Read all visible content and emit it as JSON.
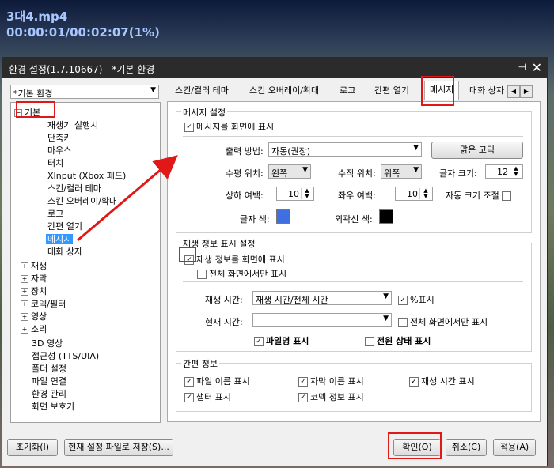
{
  "video": {
    "filename": "3대4.mp4",
    "time": "00:00:01/00:02:07(1%)"
  },
  "dialog": {
    "title": "환경 설정(1.7.10667) - *기본 환경",
    "pin_icon": "pin-icon",
    "close_icon": "close-icon"
  },
  "profile_select": {
    "value": "*기본 환경"
  },
  "tree": {
    "root": "기본",
    "children": [
      "재생기 실행시",
      "단축키",
      "마우스",
      "터치",
      "XInput (Xbox 패드)",
      "스킨/컬러 테마",
      "스킨 오버레이/확대",
      "로고",
      "간편 열기",
      "메시지",
      "대화 상자"
    ],
    "groups": [
      "재생",
      "자막",
      "장치",
      "코덱/필터",
      "영상",
      "소리"
    ],
    "leaves": [
      "3D 영상",
      "접근성 (TTS/UIA)",
      "폴더 설정",
      "파일 연결",
      "환경 관리",
      "화면 보호기"
    ]
  },
  "tabs": [
    "스킨/컬러 테마",
    "스킨 오버레이/확대",
    "로고",
    "간편 열기",
    "메시지",
    "대화 상자"
  ],
  "message_settings": {
    "group_label": "메시지 설정",
    "show_on_screen": "메시지를 화면에 표시",
    "output_method_label": "출력 방법:",
    "output_method_value": "자동(권장)",
    "font_button": "맑은 고딕",
    "h_pos_label": "수평 위치:",
    "h_pos_value": "왼쪽",
    "v_pos_label": "수직 위치:",
    "v_pos_value": "위쪽",
    "font_size_label": "글자 크기:",
    "font_size_value": "12",
    "vmargin_label": "상하 여백:",
    "vmargin_value": "10",
    "hmargin_label": "좌우 여백:",
    "hmargin_value": "10",
    "auto_size_label": "자동 크기 조절",
    "text_color_label": "글자 색:",
    "outline_color_label": "외곽선 색:",
    "text_color": "#3f6fe0",
    "outline_color": "#000000"
  },
  "playinfo": {
    "group_label": "재생 정보 표시 설정",
    "show_playinfo": "재생 정보를 화면에 표시",
    "fullscreen_only": "전체 화면에서만 표시",
    "play_time_label": "재생 시간:",
    "play_time_value": "재생 시간/전체 시간",
    "percent_label": "%표시",
    "current_time_label": "현재 시간:",
    "current_time_value": "",
    "fullscreen_only2": "전체 화면에서만 표시",
    "filename_label": "파일명 표시",
    "power_label": "전원 상태 표시"
  },
  "simple_info": {
    "group_label": "간편 정보",
    "items": [
      "파일 이름 표시",
      "자막 이름 표시",
      "재생 시간 표시",
      "챕터 표시",
      "코덱 정보 표시"
    ]
  },
  "footer": {
    "reset": "초기화(I)",
    "save_as": "현재 설정 파일로 저장(S)...",
    "ok": "확인(O)",
    "cancel": "취소(C)",
    "apply": "적용(A)"
  }
}
